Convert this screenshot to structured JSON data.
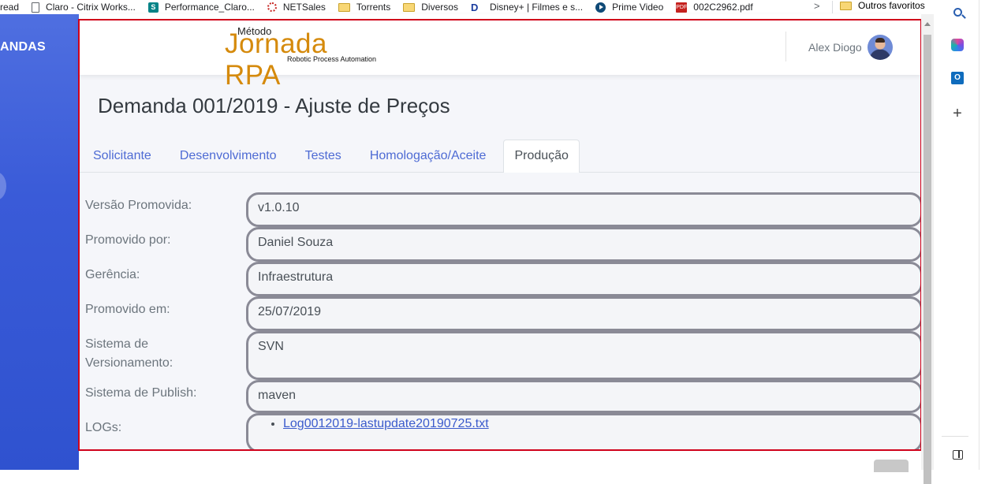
{
  "bookmarks": {
    "items": [
      {
        "label": "read",
        "icon": "none"
      },
      {
        "label": "Claro - Citrix Works...",
        "icon": "page-icon"
      },
      {
        "label": "Performance_Claro...",
        "icon": "sharepoint-icon"
      },
      {
        "label": "NETSales",
        "icon": "spinner-icon"
      },
      {
        "label": "Torrents",
        "icon": "folder-icon"
      },
      {
        "label": "Diversos",
        "icon": "folder-icon"
      },
      {
        "label": "Disney+ | Filmes e s...",
        "icon": "disney-icon"
      },
      {
        "label": "Prime Video",
        "icon": "prime-video-icon"
      },
      {
        "label": "002C2962.pdf",
        "icon": "pdf-icon"
      }
    ],
    "overflow_chevron": ">",
    "other_favorites": "Outros favoritos"
  },
  "app": {
    "sidebar_title": "ANDAS",
    "logo": {
      "pre": "Método",
      "main": "Jornada RPA",
      "sub": "Robotic Process Automation"
    },
    "user_name": "Alex Diogo",
    "page_title": "Demanda 001/2019 - Ajuste de Preços",
    "tabs": [
      {
        "label": "Solicitante"
      },
      {
        "label": "Desenvolvimento"
      },
      {
        "label": "Testes"
      },
      {
        "label": "Homologação/Aceite"
      },
      {
        "label": "Produção"
      }
    ],
    "active_tab": "Produção",
    "form": {
      "versao_label": "Versão Promovida:",
      "versao_value": "v1.0.10",
      "promovido_por_label": "Promovido por:",
      "promovido_por_value": "Daniel Souza",
      "gerencia_label": "Gerência:",
      "gerencia_value": "Infraestrutura",
      "promovido_em_label": "Promovido em:",
      "promovido_em_value": "25/07/2019",
      "sistema_versionamento_label_line1": "Sistema de",
      "sistema_versionamento_label_line2": "Versionamento:",
      "sistema_versionamento_value": "SVN",
      "sistema_publish_label": "Sistema de Publish:",
      "sistema_publish_value": "maven",
      "logs_label": "LOGs:",
      "logs": [
        "Log0012019-lastupdate20190725.txt"
      ]
    }
  },
  "colors": {
    "sidebar": "#3a5bd8",
    "logo": "#d58a0c",
    "tab_link": "#4e6bd4",
    "highlight_frame": "#d0021b"
  }
}
